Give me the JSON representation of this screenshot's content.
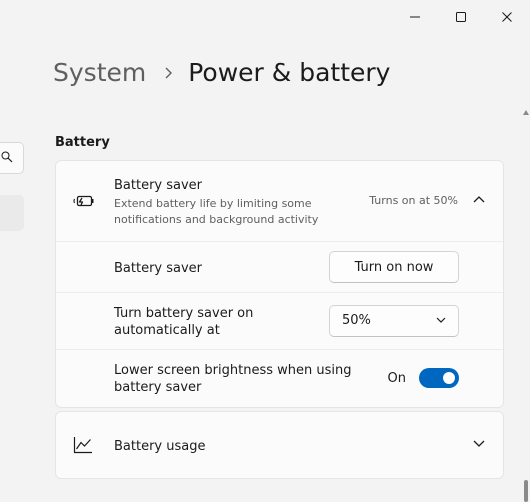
{
  "window": {
    "controls": [
      {
        "icon": "minimize-icon"
      },
      {
        "icon": "maximize-icon"
      },
      {
        "icon": "close-icon"
      }
    ]
  },
  "breadcrumb": {
    "parent": "System",
    "separator_icon": "chevron-right-icon",
    "current": "Power & battery"
  },
  "nav": {
    "search_icon": "search-icon"
  },
  "battery_section": {
    "title": "Battery",
    "saver": {
      "icon": "battery-saver-icon",
      "title": "Battery saver",
      "description": "Extend battery life by limiting some notifications and background activity",
      "status": "Turns on at 50%",
      "expanded": true,
      "rows": {
        "turn_on_now": {
          "label": "Battery saver",
          "button_label": "Turn on now"
        },
        "auto_on": {
          "label": "Turn battery saver on automatically at",
          "selected_value": "50%"
        },
        "brightness": {
          "label": "Lower screen brightness when using battery saver",
          "toggle_state_label": "On",
          "toggle_on": true
        }
      }
    },
    "usage": {
      "icon": "chart-line-icon",
      "title": "Battery usage",
      "expanded": false
    }
  },
  "colors": {
    "accent": "#0067c0",
    "background": "#f3f3f3",
    "card": "#fbfbfb",
    "text_primary": "#1b1b1b",
    "text_secondary": "#5f5f5f"
  }
}
